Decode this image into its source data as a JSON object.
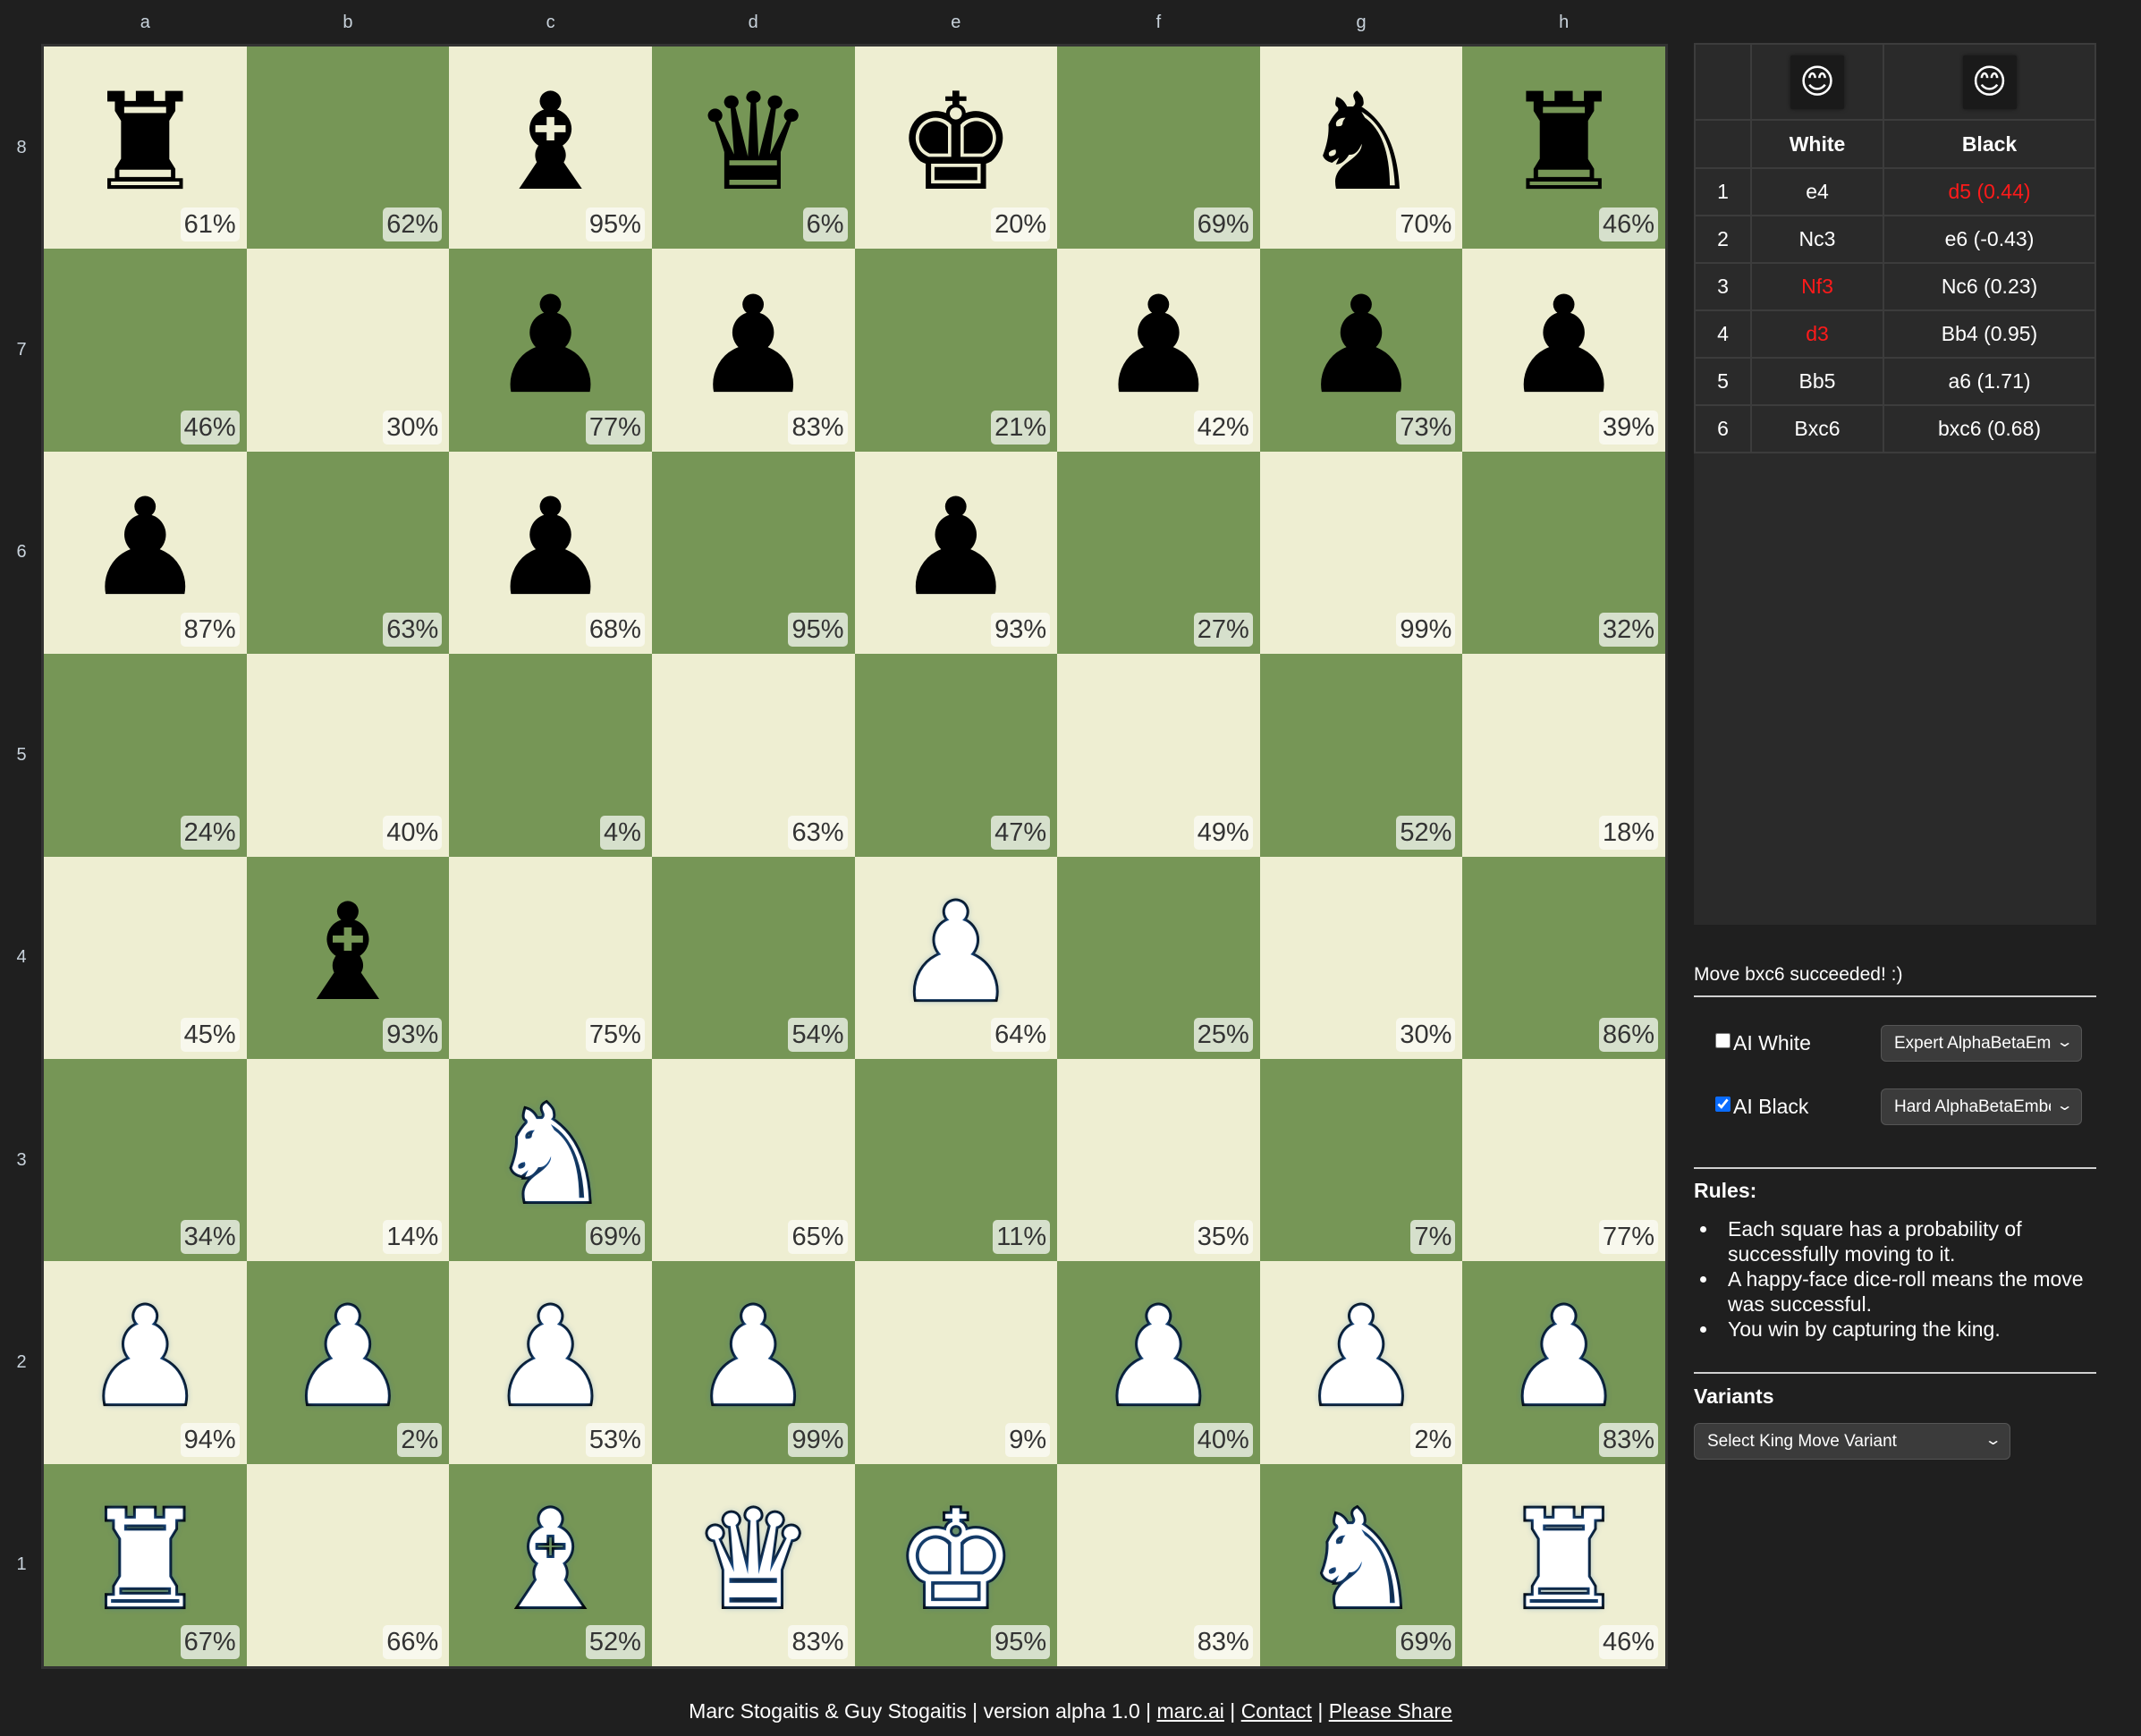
{
  "board": {
    "files": [
      "a",
      "b",
      "c",
      "d",
      "e",
      "f",
      "g",
      "h"
    ],
    "ranks": [
      "8",
      "7",
      "6",
      "5",
      "4",
      "3",
      "2",
      "1"
    ],
    "squares": [
      [
        {
          "piece": "rook",
          "color": "black",
          "glyph": "♜",
          "pct": "61%"
        },
        {
          "piece": "",
          "color": "",
          "glyph": "",
          "pct": "62%"
        },
        {
          "piece": "bishop",
          "color": "black",
          "glyph": "♝",
          "pct": "95%"
        },
        {
          "piece": "queen",
          "color": "black",
          "glyph": "♛",
          "pct": "6%"
        },
        {
          "piece": "king",
          "color": "black",
          "glyph": "♚",
          "pct": "20%"
        },
        {
          "piece": "",
          "color": "",
          "glyph": "",
          "pct": "69%"
        },
        {
          "piece": "knight",
          "color": "black",
          "glyph": "♞",
          "pct": "70%"
        },
        {
          "piece": "rook",
          "color": "black",
          "glyph": "♜",
          "pct": "46%"
        }
      ],
      [
        {
          "piece": "",
          "color": "",
          "glyph": "",
          "pct": "46%"
        },
        {
          "piece": "",
          "color": "",
          "glyph": "",
          "pct": "30%"
        },
        {
          "piece": "pawn",
          "color": "black",
          "glyph": "♟",
          "pct": "77%"
        },
        {
          "piece": "pawn",
          "color": "black",
          "glyph": "♟",
          "pct": "83%"
        },
        {
          "piece": "",
          "color": "",
          "glyph": "",
          "pct": "21%"
        },
        {
          "piece": "pawn",
          "color": "black",
          "glyph": "♟",
          "pct": "42%"
        },
        {
          "piece": "pawn",
          "color": "black",
          "glyph": "♟",
          "pct": "73%"
        },
        {
          "piece": "pawn",
          "color": "black",
          "glyph": "♟",
          "pct": "39%"
        }
      ],
      [
        {
          "piece": "pawn",
          "color": "black",
          "glyph": "♟",
          "pct": "87%"
        },
        {
          "piece": "",
          "color": "",
          "glyph": "",
          "pct": "63%"
        },
        {
          "piece": "pawn",
          "color": "black",
          "glyph": "♟",
          "pct": "68%"
        },
        {
          "piece": "",
          "color": "",
          "glyph": "",
          "pct": "95%"
        },
        {
          "piece": "pawn",
          "color": "black",
          "glyph": "♟",
          "pct": "93%"
        },
        {
          "piece": "",
          "color": "",
          "glyph": "",
          "pct": "27%"
        },
        {
          "piece": "",
          "color": "",
          "glyph": "",
          "pct": "99%"
        },
        {
          "piece": "",
          "color": "",
          "glyph": "",
          "pct": "32%"
        }
      ],
      [
        {
          "piece": "",
          "color": "",
          "glyph": "",
          "pct": "24%"
        },
        {
          "piece": "",
          "color": "",
          "glyph": "",
          "pct": "40%"
        },
        {
          "piece": "",
          "color": "",
          "glyph": "",
          "pct": "4%"
        },
        {
          "piece": "",
          "color": "",
          "glyph": "",
          "pct": "63%"
        },
        {
          "piece": "",
          "color": "",
          "glyph": "",
          "pct": "47%"
        },
        {
          "piece": "",
          "color": "",
          "glyph": "",
          "pct": "49%"
        },
        {
          "piece": "",
          "color": "",
          "glyph": "",
          "pct": "52%"
        },
        {
          "piece": "",
          "color": "",
          "glyph": "",
          "pct": "18%"
        }
      ],
      [
        {
          "piece": "",
          "color": "",
          "glyph": "",
          "pct": "45%"
        },
        {
          "piece": "bishop",
          "color": "black",
          "glyph": "♝",
          "pct": "93%"
        },
        {
          "piece": "",
          "color": "",
          "glyph": "",
          "pct": "75%"
        },
        {
          "piece": "",
          "color": "",
          "glyph": "",
          "pct": "54%"
        },
        {
          "piece": "pawn",
          "color": "white",
          "glyph": "♟",
          "pct": "64%"
        },
        {
          "piece": "",
          "color": "",
          "glyph": "",
          "pct": "25%"
        },
        {
          "piece": "",
          "color": "",
          "glyph": "",
          "pct": "30%"
        },
        {
          "piece": "",
          "color": "",
          "glyph": "",
          "pct": "86%"
        }
      ],
      [
        {
          "piece": "",
          "color": "",
          "glyph": "",
          "pct": "34%"
        },
        {
          "piece": "",
          "color": "",
          "glyph": "",
          "pct": "14%"
        },
        {
          "piece": "knight",
          "color": "white",
          "glyph": "♞",
          "pct": "69%"
        },
        {
          "piece": "",
          "color": "",
          "glyph": "",
          "pct": "65%"
        },
        {
          "piece": "",
          "color": "",
          "glyph": "",
          "pct": "11%"
        },
        {
          "piece": "",
          "color": "",
          "glyph": "",
          "pct": "35%"
        },
        {
          "piece": "",
          "color": "",
          "glyph": "",
          "pct": "7%"
        },
        {
          "piece": "",
          "color": "",
          "glyph": "",
          "pct": "77%"
        }
      ],
      [
        {
          "piece": "pawn",
          "color": "white",
          "glyph": "♟",
          "pct": "94%"
        },
        {
          "piece": "pawn",
          "color": "white",
          "glyph": "♟",
          "pct": "2%"
        },
        {
          "piece": "pawn",
          "color": "white",
          "glyph": "♟",
          "pct": "53%"
        },
        {
          "piece": "pawn",
          "color": "white",
          "glyph": "♟",
          "pct": "99%"
        },
        {
          "piece": "",
          "color": "",
          "glyph": "",
          "pct": "9%"
        },
        {
          "piece": "pawn",
          "color": "white",
          "glyph": "♟",
          "pct": "40%"
        },
        {
          "piece": "pawn",
          "color": "white",
          "glyph": "♟",
          "pct": "2%"
        },
        {
          "piece": "pawn",
          "color": "white",
          "glyph": "♟",
          "pct": "83%"
        }
      ],
      [
        {
          "piece": "rook",
          "color": "white",
          "glyph": "♜",
          "pct": "67%"
        },
        {
          "piece": "",
          "color": "",
          "glyph": "",
          "pct": "66%"
        },
        {
          "piece": "bishop",
          "color": "white",
          "glyph": "♝",
          "pct": "52%"
        },
        {
          "piece": "queen",
          "color": "white",
          "glyph": "♛",
          "pct": "83%"
        },
        {
          "piece": "king",
          "color": "white",
          "glyph": "♚",
          "pct": "95%"
        },
        {
          "piece": "",
          "color": "",
          "glyph": "",
          "pct": "83%"
        },
        {
          "piece": "knight",
          "color": "white",
          "glyph": "♞",
          "pct": "69%"
        },
        {
          "piece": "rook",
          "color": "white",
          "glyph": "♜",
          "pct": "46%"
        }
      ]
    ],
    "colors": {
      "light": "#eeeed2",
      "dark": "#769656"
    }
  },
  "movelist": {
    "dice": {
      "white": "😊",
      "black": "😊",
      "icon": "happy-face-dice-icon"
    },
    "headers": {
      "num": "",
      "white": "White",
      "black": "Black"
    },
    "moves": [
      {
        "num": "1",
        "white": "e4",
        "white_failed": false,
        "black": "d5 (0.44)",
        "black_failed": true
      },
      {
        "num": "2",
        "white": "Nc3",
        "white_failed": false,
        "black": "e6 (-0.43)",
        "black_failed": false
      },
      {
        "num": "3",
        "white": "Nf3",
        "white_failed": true,
        "black": "Nc6 (0.23)",
        "black_failed": false
      },
      {
        "num": "4",
        "white": "d3",
        "white_failed": true,
        "black": "Bb4 (0.95)",
        "black_failed": false
      },
      {
        "num": "5",
        "white": "Bb5",
        "white_failed": false,
        "black": "a6 (1.71)",
        "black_failed": false
      },
      {
        "num": "6",
        "white": "Bxc6",
        "white_failed": false,
        "black": "bxc6 (0.68)",
        "black_failed": false
      }
    ],
    "failed_color": "#ff1a1a"
  },
  "status": "Move bxc6 succeeded! :)",
  "ai": {
    "white": {
      "label": "AI White",
      "checked": false,
      "engine": "Expert AlphaBetaEmbedding"
    },
    "black": {
      "label": "AI Black",
      "checked": true,
      "engine": "Hard AlphaBetaEmbedding"
    }
  },
  "rules": {
    "title": "Rules:",
    "items": [
      "Each square has a probability of successfully moving to it.",
      "A happy-face dice-roll means the move was successful.",
      "You win by capturing the king."
    ]
  },
  "variants": {
    "title": "Variants",
    "selected": "Select King Move Variant"
  },
  "footer": {
    "authors": "Marc Stogaitis & Guy Stogaitis",
    "version": "version alpha 1.0",
    "links": [
      "marc.ai",
      "Contact",
      "Please Share"
    ],
    "sep": " | "
  }
}
